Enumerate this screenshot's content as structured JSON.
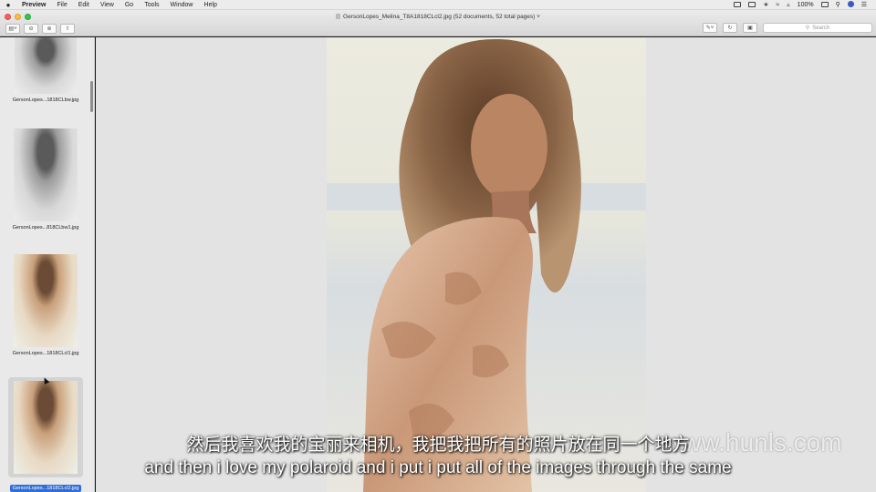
{
  "menubar": {
    "apple": "",
    "app_name": "Preview",
    "items": [
      "File",
      "Edit",
      "View",
      "Go",
      "Tools",
      "Window",
      "Help"
    ],
    "battery": "100%"
  },
  "window": {
    "title": "GersonLopes_Melina_T8A1818CLcl2.jpg (52 documents, 52 total pages)",
    "search_placeholder": "Search"
  },
  "sidebar": {
    "thumbnails": [
      {
        "label": "GersonLopes...1818CLbw.jpg",
        "style": "bw",
        "selected": false
      },
      {
        "label": "GersonLopes...818CLbw1.jpg",
        "style": "bw",
        "selected": false
      },
      {
        "label": "GersonLopes...1818CLcl1.jpg",
        "style": "color",
        "selected": false
      },
      {
        "label": "GersonLopes...1818CLcl2.jpg",
        "style": "color",
        "selected": true
      }
    ]
  },
  "subtitles": {
    "chinese": "然后我喜欢我的宝丽来相机，我把我把所有的照片放在同一个地方",
    "english": "and then i love my polaroid and i put i put all of the images through the same"
  },
  "watermark": "www.hunls.com",
  "colors": {
    "selection": "#2e6ed6",
    "close": "#fc605c",
    "minimize": "#fdbc40",
    "maximize": "#34c84a"
  }
}
